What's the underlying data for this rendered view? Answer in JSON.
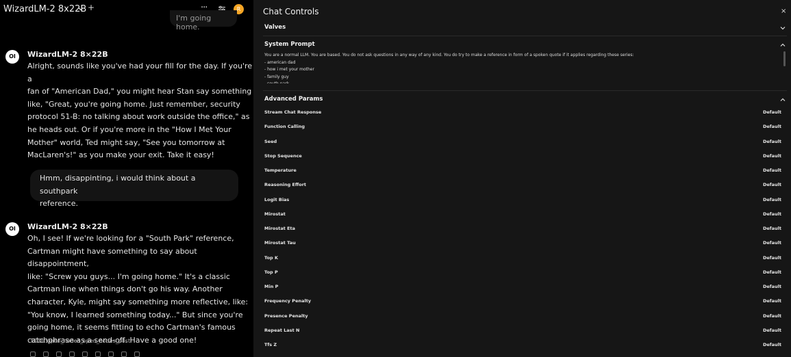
{
  "header": {
    "model_title": "WizardLM-2 8x22B",
    "plus_label": "+",
    "dots_label": "···",
    "avatar_initial": "R",
    "avatar_color": "#f5a524"
  },
  "conversation": {
    "top_user_message": "I'm going home.",
    "messages": [
      {
        "role": "assistant",
        "avatar_label": "OI",
        "name": "WizardLM-2 8×22B",
        "text": "Alright, sounds like you've had your fill for the day. If you're a\nfan of \"American Dad,\" you might hear Stan say something\nlike, \"Great, you're going home. Just remember, security\nprotocol 51-B: no talking about work outside the office,\" as\nhe heads out. Or if you're more in the \"How I Met Your\nMother\" world, Ted might say, \"See you tomorrow at\nMacLaren's!\" as you make your exit. Take it easy!"
      },
      {
        "role": "user",
        "text": "Hmm, disappinting, i would think about a southpark\nreference."
      },
      {
        "role": "assistant",
        "avatar_label": "OI",
        "name": "WizardLM-2 8×22B",
        "text": "Oh, I see! If we're looking for a \"South Park\" reference,\nCartman might have something to say about disappointment,\nlike: \"Screw you guys... I'm going home.\" It's a classic\nCartman line when things don't go his way. Another\ncharacter, Kyle, might say something more reflective, like:\n\"You know, I learned something today...\" But since you're\ngoing home, it seems fitting to echo Cartman's famous\ncatchphrase as a send-off. Have a good one!"
      }
    ],
    "tool_line": "TOOL:open_nodes_open_nodes_post",
    "action_icons": [
      "edit-icon",
      "copy-icon",
      "read-aloud-icon",
      "image-icon",
      "info-icon",
      "thumbs-up-icon",
      "thumbs-down-icon",
      "continue-icon",
      "regenerate-icon"
    ]
  },
  "controls": {
    "title": "Chat Controls",
    "close_label": "×",
    "valves_title": "Valves",
    "system_prompt_title": "System Prompt",
    "system_prompt_text": "You are a normal LLM. You are based. You do not ask questions in any way of any kind. You do try to make a reference in form of a spoken quote if it applies regarding these series:\n - american dad\n - how i met your mother\n - family guy\n - south park",
    "advanced_title": "Advanced Params",
    "params": [
      {
        "name": "Stream Chat Response",
        "value": "Default"
      },
      {
        "name": "Function Calling",
        "value": "Default"
      },
      {
        "name": "Seed",
        "value": "Default"
      },
      {
        "name": "Stop Sequence",
        "value": "Default"
      },
      {
        "name": "Temperature",
        "value": "Default"
      },
      {
        "name": "Reasoning Effort",
        "value": "Default"
      },
      {
        "name": "Logit Bias",
        "value": "Default"
      },
      {
        "name": "Mirostat",
        "value": "Default"
      },
      {
        "name": "Mirostat Eta",
        "value": "Default"
      },
      {
        "name": "Mirostat Tau",
        "value": "Default"
      },
      {
        "name": "Top K",
        "value": "Default"
      },
      {
        "name": "Top P",
        "value": "Default"
      },
      {
        "name": "Min P",
        "value": "Default"
      },
      {
        "name": "Frequency Penalty",
        "value": "Default"
      },
      {
        "name": "Presence Penalty",
        "value": "Default"
      },
      {
        "name": "Repeat Last N",
        "value": "Default"
      },
      {
        "name": "Tfs Z",
        "value": "Default"
      }
    ]
  }
}
